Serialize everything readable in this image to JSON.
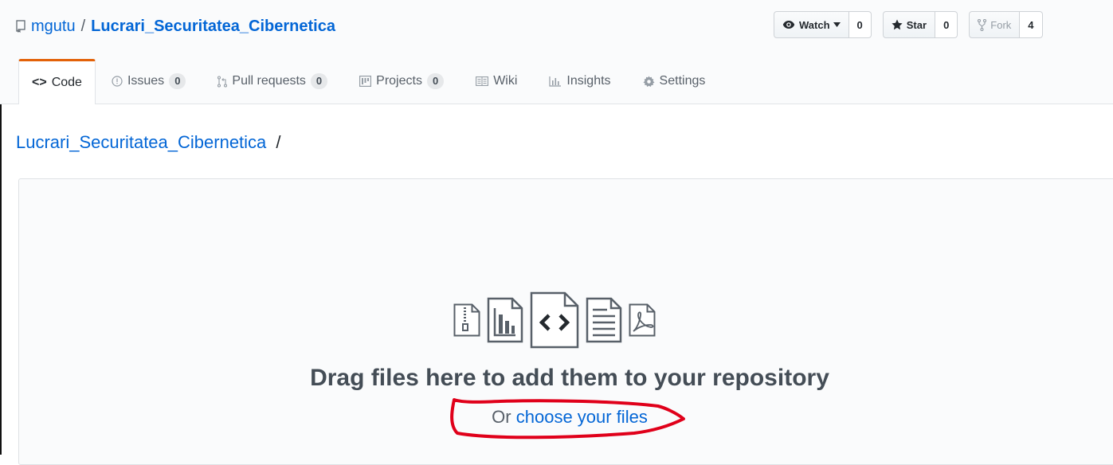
{
  "header": {
    "owner": "mgutu",
    "separator": "/",
    "repo_name": "Lucrari_Securitatea_Cibernetica"
  },
  "actions": {
    "watch": {
      "label": "Watch",
      "count": "0"
    },
    "star": {
      "label": "Star",
      "count": "0"
    },
    "fork": {
      "label": "Fork",
      "count": "4"
    }
  },
  "tabs": [
    {
      "label": "Code",
      "icon": "code-icon"
    },
    {
      "label": "Issues",
      "icon": "issue-icon",
      "count": "0"
    },
    {
      "label": "Pull requests",
      "icon": "pull-request-icon",
      "count": "0"
    },
    {
      "label": "Projects",
      "icon": "project-icon",
      "count": "0"
    },
    {
      "label": "Wiki",
      "icon": "book-icon"
    },
    {
      "label": "Insights",
      "icon": "graph-icon"
    },
    {
      "label": "Settings",
      "icon": "gear-icon"
    }
  ],
  "breadcrumb": {
    "repo": "Lucrari_Securitatea_Cibernetica",
    "separator": "/"
  },
  "upload": {
    "drag_text": "Drag files here to add them to your repository",
    "or_text": "Or",
    "choose_link": "choose your files"
  },
  "colors": {
    "link": "#0366d6",
    "selected_tab_accent": "#e36209",
    "annotation": "#e0001a"
  }
}
